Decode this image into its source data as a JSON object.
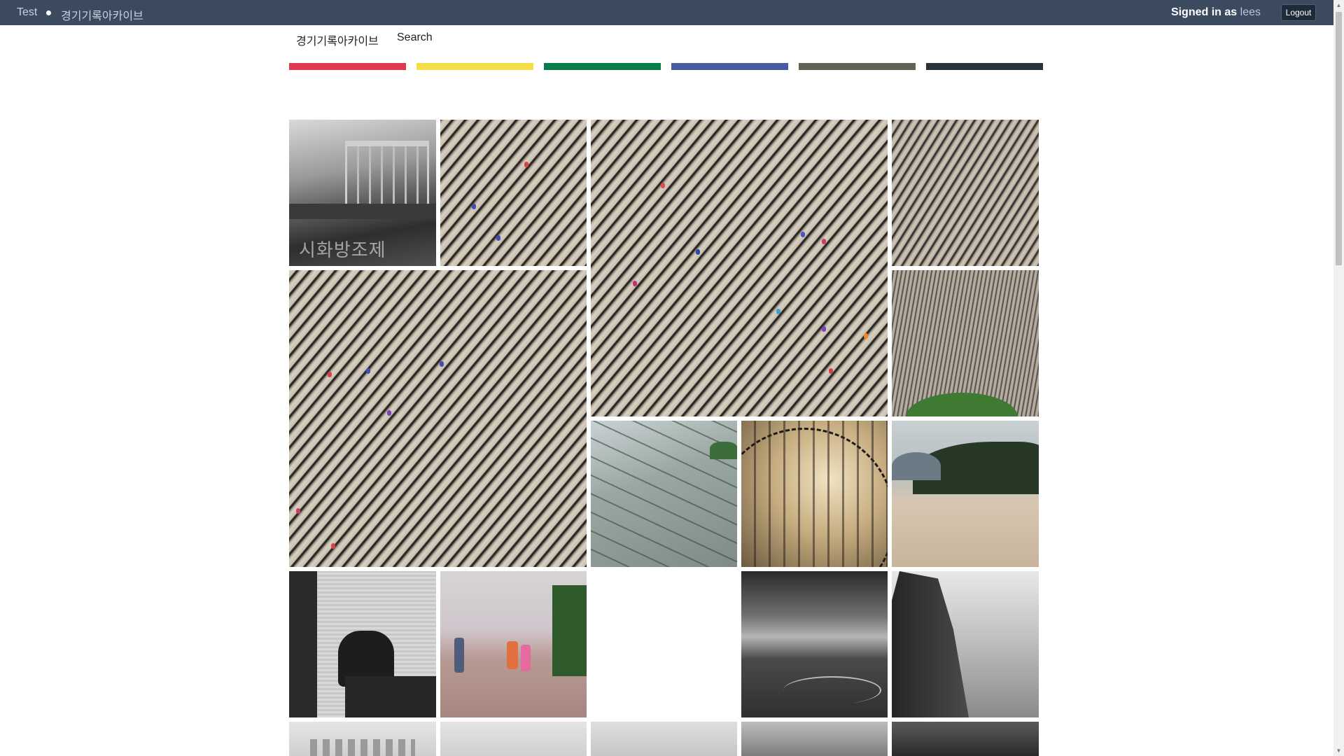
{
  "topbar": {
    "site_label": "Test",
    "archive_label": "경기기록아카이브",
    "signed_in_prefix": "Signed in as",
    "username": "lees",
    "logout_label": "Logout"
  },
  "subnav": {
    "archive_link": "경기기록아카이브",
    "search_link": "Search"
  },
  "color_bars": [
    "#e0384e",
    "#f5de46",
    "#067d4a",
    "#455da0",
    "#606354",
    "#27323f"
  ],
  "photos": [
    {
      "id": "sihwa-dike",
      "watermark": "시화방조제"
    },
    {
      "id": "field-workers-1"
    },
    {
      "id": "field-workers-large"
    },
    {
      "id": "field-aerial-1"
    },
    {
      "id": "field-workers-2"
    },
    {
      "id": "field-aerial-hill"
    },
    {
      "id": "terraced-paddies"
    },
    {
      "id": "barbed-wire"
    },
    {
      "id": "coast-forest"
    },
    {
      "id": "soldier-guard-post"
    },
    {
      "id": "children-walkway"
    },
    {
      "id": "tidal-flat-bw"
    },
    {
      "id": "rock-coast-bw"
    },
    {
      "id": "city-skyline-bw"
    },
    {
      "id": "grey-sky-bw"
    },
    {
      "id": "clouds-bw"
    },
    {
      "id": "sky-landscape-bw"
    },
    {
      "id": "dark-coast-bw"
    }
  ]
}
